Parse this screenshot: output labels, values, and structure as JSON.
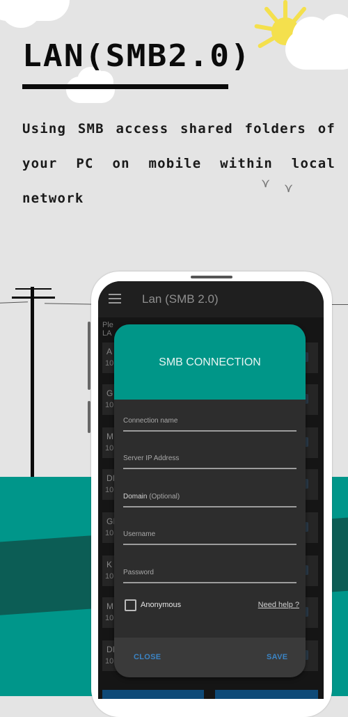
{
  "promo": {
    "title": "LAN(SMB2.0)",
    "subtitle": "Using SMB access shared folders of your PC on mobile within local network"
  },
  "app": {
    "title": "Lan (SMB 2.0)",
    "menu_icon": "hamburger-menu-icon",
    "hint_text": [
      "Ple",
      "LA"
    ],
    "list_rows": [
      {
        "name": "A",
        "ip": "10."
      },
      {
        "name": "G",
        "ip": "10."
      },
      {
        "name": "M",
        "ip": "10."
      },
      {
        "name": "DI",
        "ip": "10."
      },
      {
        "name": "GI",
        "ip": "10."
      },
      {
        "name": "K",
        "ip": "10."
      },
      {
        "name": "M",
        "ip": "10."
      },
      {
        "name": "DI",
        "ip": "10."
      }
    ]
  },
  "dialog": {
    "title": "SMB CONNECTION",
    "fields": [
      {
        "label": "Connection name",
        "value": ""
      },
      {
        "label": "Server IP Address",
        "value": ""
      },
      {
        "label": "Domain",
        "hint": "(Optional)",
        "value": ""
      },
      {
        "label": "Username",
        "value": ""
      },
      {
        "label": "Password",
        "value": ""
      }
    ],
    "anonymous_label": "Anonymous",
    "anonymous_checked": false,
    "help_link": "Need help ?",
    "close_label": "CLOSE",
    "save_label": "SAVE"
  },
  "colors": {
    "accent": "#009688",
    "button_text": "#3b84c4",
    "dialog_bg": "#2d2d2d",
    "hill_dark": "#0c5d55"
  }
}
